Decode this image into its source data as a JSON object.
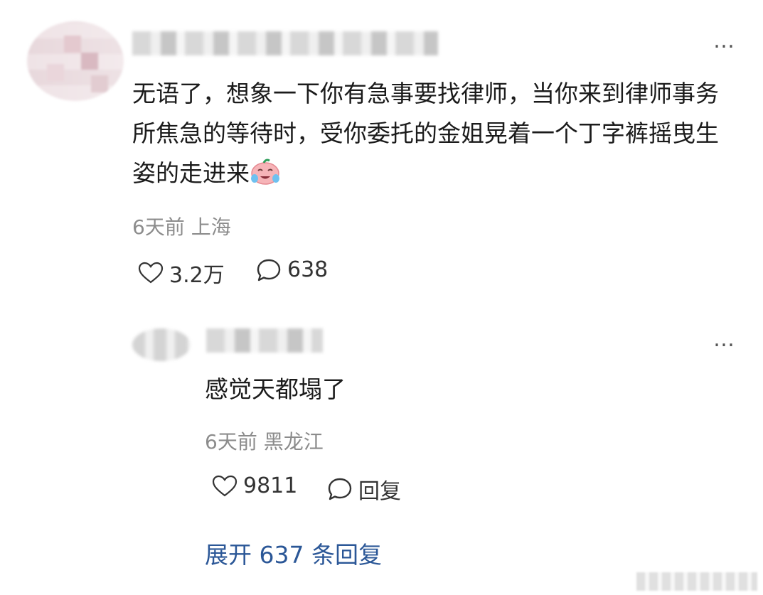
{
  "comment": {
    "text": "无语了，想象一下你有急事要找律师，当你来到律师事务所焦急的等待时，受你委托的金姐晃着一个丁字裤摇曳生姿的走进来",
    "time": "6天前",
    "location": "上海",
    "likes": "3.2万",
    "replies": "638",
    "emoji_icon": "laughing-crying-face-icon"
  },
  "reply": {
    "text": "感觉天都塌了",
    "time": "6天前",
    "location": "黑龙江",
    "likes": "9811",
    "reply_label": "回复"
  },
  "more_label": "…",
  "expand_label": "展开 637 条回复",
  "colors": {
    "link": "#2b5797",
    "meta": "#8c8c8c",
    "text": "#1b1b1b"
  }
}
